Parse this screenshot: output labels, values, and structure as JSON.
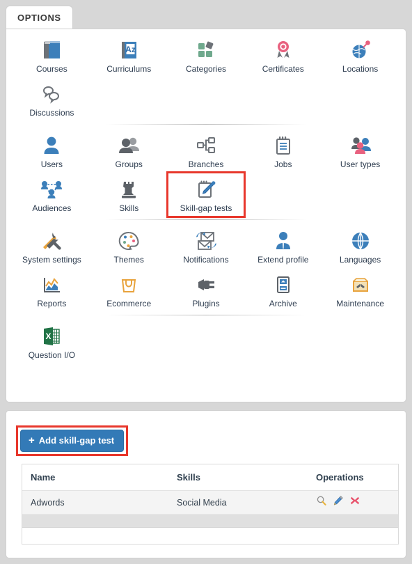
{
  "tab": {
    "label": "OPTIONS"
  },
  "options_panel": {
    "groups": [
      {
        "name": "content-group",
        "rows": [
          [
            {
              "label": "Courses",
              "icon": "book-icon"
            },
            {
              "label": "Curriculums",
              "icon": "az-book-icon"
            },
            {
              "label": "Categories",
              "icon": "squares-icon"
            },
            {
              "label": "Certificates",
              "icon": "ribbon-icon"
            },
            {
              "label": "Locations",
              "icon": "globe-pin-icon"
            }
          ],
          [
            {
              "label": "Discussions",
              "icon": "speech-bubbles-icon"
            },
            {
              "label": "",
              "icon": ""
            },
            {
              "label": "",
              "icon": ""
            },
            {
              "label": "",
              "icon": ""
            },
            {
              "label": "",
              "icon": ""
            }
          ]
        ]
      },
      {
        "name": "users-group",
        "rows": [
          [
            {
              "label": "Users",
              "icon": "user-icon"
            },
            {
              "label": "Groups",
              "icon": "group-icon"
            },
            {
              "label": "Branches",
              "icon": "branches-icon"
            },
            {
              "label": "Jobs",
              "icon": "notepad-icon"
            },
            {
              "label": "User types",
              "icon": "user-types-icon"
            }
          ],
          [
            {
              "label": "Audiences",
              "icon": "audiences-icon"
            },
            {
              "label": "Skills",
              "icon": "rook-icon"
            },
            {
              "label": "Skill-gap tests",
              "icon": "pencil-pad-icon",
              "highlighted": true
            },
            {
              "label": "",
              "icon": ""
            },
            {
              "label": "",
              "icon": ""
            }
          ]
        ]
      },
      {
        "name": "system-group",
        "rows": [
          [
            {
              "label": "System settings",
              "icon": "tools-icon"
            },
            {
              "label": "Themes",
              "icon": "palette-icon"
            },
            {
              "label": "Notifications",
              "icon": "envelope-sync-icon"
            },
            {
              "label": "Extend profile",
              "icon": "profile-tie-icon"
            },
            {
              "label": "Languages",
              "icon": "globe-icon"
            }
          ],
          [
            {
              "label": "Reports",
              "icon": "chart-icon"
            },
            {
              "label": "Ecommerce",
              "icon": "basket-icon"
            },
            {
              "label": "Plugins",
              "icon": "plug-icon"
            },
            {
              "label": "Archive",
              "icon": "archive-icon"
            },
            {
              "label": "Maintenance",
              "icon": "maintenance-icon"
            }
          ]
        ]
      },
      {
        "name": "tools-group",
        "rows": [
          [
            {
              "label": "Question I/O",
              "icon": "excel-icon"
            },
            {
              "label": "",
              "icon": ""
            },
            {
              "label": "",
              "icon": ""
            },
            {
              "label": "",
              "icon": ""
            },
            {
              "label": "",
              "icon": ""
            }
          ]
        ]
      }
    ]
  },
  "list_panel": {
    "add_button": {
      "label": "Add skill-gap test",
      "plus": "+"
    },
    "table": {
      "columns": [
        "Name",
        "Skills",
        "Operations"
      ],
      "rows": [
        {
          "name": "Adwords",
          "skills": "Social Media",
          "operations": [
            "view-icon",
            "edit-icon",
            "delete-icon"
          ]
        }
      ]
    }
  },
  "colors": {
    "highlight": "#e8372c",
    "button": "#337ab7",
    "accent_blue": "#3c7fba",
    "accent_gray": "#6d7278",
    "accent_pink": "#ea6f8a",
    "accent_green": "#6fa98d",
    "accent_orange": "#e8a33d"
  }
}
